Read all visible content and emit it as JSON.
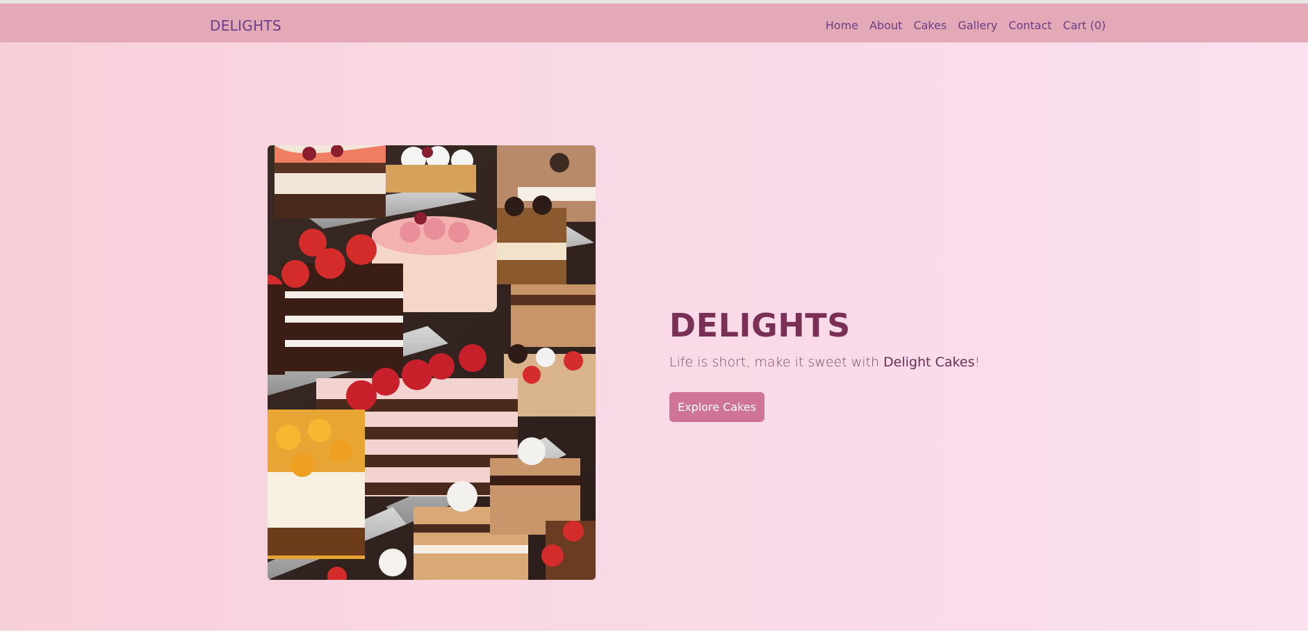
{
  "navbar": {
    "brand": "DELIGHTS",
    "links": [
      {
        "label": "Home"
      },
      {
        "label": "About"
      },
      {
        "label": "Cakes"
      },
      {
        "label": "Gallery"
      },
      {
        "label": "Contact"
      },
      {
        "label": "Cart (0)"
      }
    ]
  },
  "hero": {
    "image_description_icon": "cake-display-photo",
    "title": "DELIGHTS",
    "tagline_prefix": "Life is short, make it sweet with ",
    "tagline_brand": "Delight Cakes",
    "tagline_suffix": "!",
    "cta_label": "Explore Cakes"
  },
  "colors": {
    "navbar_bg": "#e3a9b7",
    "brand_text": "#6a3e86",
    "hero_title": "#7a2f55",
    "cta_bg": "#cf7496"
  }
}
